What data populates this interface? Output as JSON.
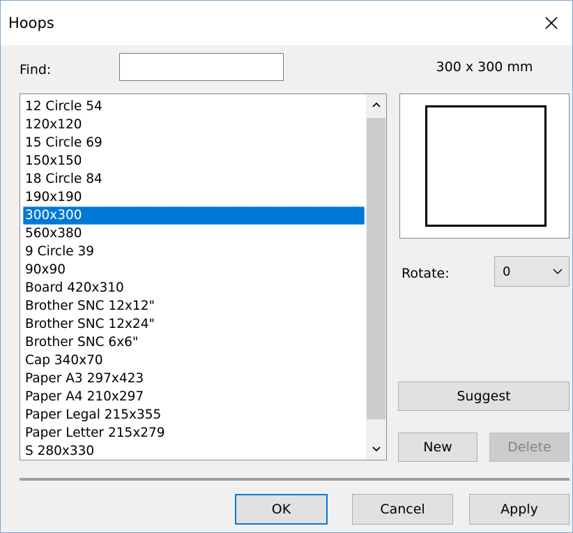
{
  "window": {
    "title": "Hoops",
    "close_icon": "close-icon"
  },
  "find": {
    "label": "Find:",
    "value": "",
    "placeholder": ""
  },
  "preview": {
    "dimensions": "300 x 300 mm",
    "shape": "square"
  },
  "hoop_list": {
    "items": [
      "12 Circle 54",
      "120x120",
      "15 Circle 69",
      "150x150",
      "18 Circle 84",
      "190x190",
      "300x300",
      "560x380",
      "9 Circle 39",
      "90x90",
      "Board 420x310",
      "Brother SNC 12x12\"",
      "Brother SNC 12x24\"",
      "Brother SNC 6x6\"",
      "Cap 340x70",
      "Paper A3 297x423",
      "Paper A4 210x297",
      "Paper Legal 215x355",
      "Paper Letter 215x279",
      "S 280x330"
    ],
    "selected": "300x300"
  },
  "rotate": {
    "label": "Rotate:",
    "value": "0"
  },
  "buttons": {
    "suggest": "Suggest",
    "new": "New",
    "delete": "Delete",
    "ok": "OK",
    "cancel": "Cancel",
    "apply": "Apply"
  },
  "colors": {
    "selection": "#0078d7",
    "default_button_border": "#0078d7",
    "window_background": "#f0f0f0"
  }
}
